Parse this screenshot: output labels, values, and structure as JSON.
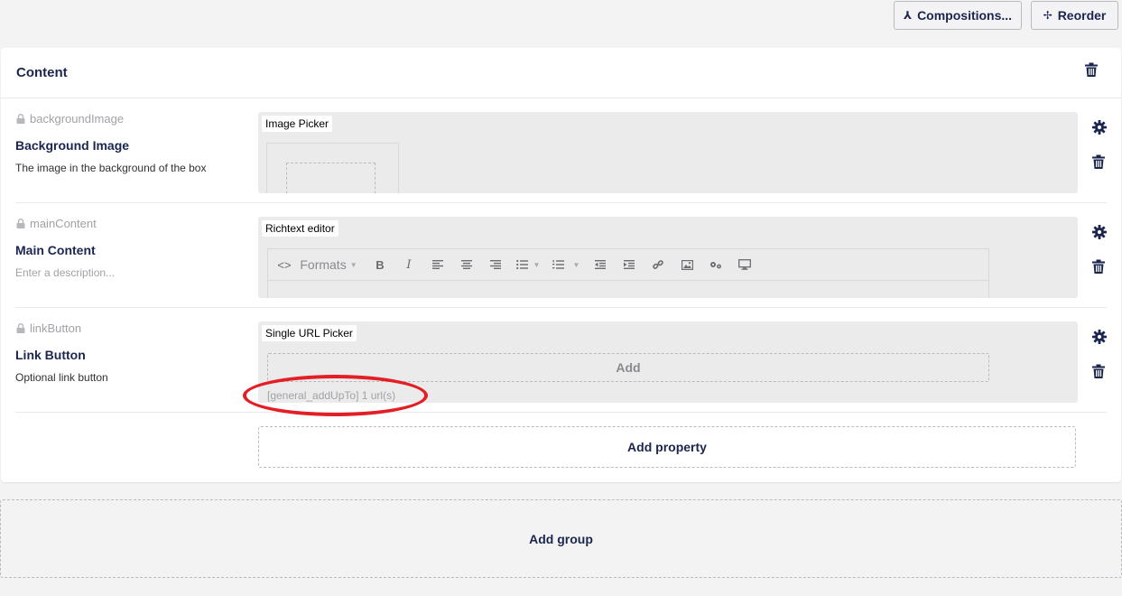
{
  "toolbar": {
    "compositions_label": "Compositions...",
    "reorder_label": "Reorder"
  },
  "group": {
    "title": "Content",
    "add_property_label": "Add property"
  },
  "properties": [
    {
      "alias": "backgroundImage",
      "name": "Background Image",
      "description": "The image in the background of the box",
      "editor": "Image Picker"
    },
    {
      "alias": "mainContent",
      "name": "Main Content",
      "description": "Enter a description...",
      "editor": "Richtext editor",
      "formats_label": "Formats"
    },
    {
      "alias": "linkButton",
      "name": "Link Button",
      "description": "Optional link button",
      "editor": "Single URL Picker",
      "add_label": "Add",
      "hint": "[general_addUpTo] 1 url(s)"
    }
  ],
  "add_group_label": "Add group",
  "colors": {
    "annotation": "#e31e24",
    "text_primary": "#1b264f",
    "background": "#f4f3f4"
  }
}
